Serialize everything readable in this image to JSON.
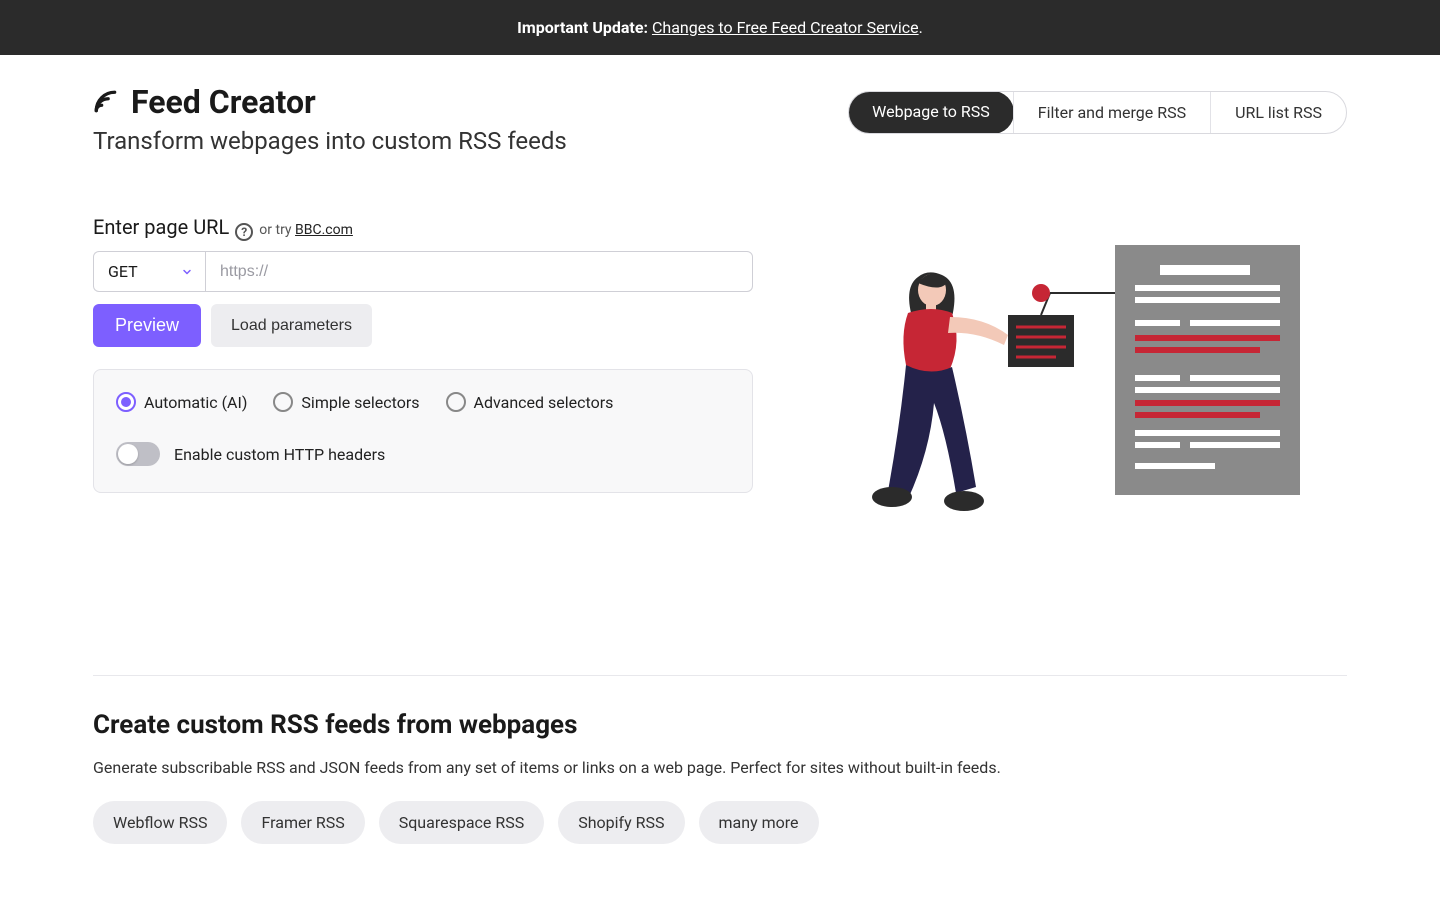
{
  "banner": {
    "prefix": "Important Update:",
    "link_text": "Changes to Free Feed Creator Service",
    "suffix": "."
  },
  "header": {
    "title": "Feed Creator",
    "subtitle": "Transform webpages into custom RSS feeds"
  },
  "tabs": [
    {
      "label": "Webpage to RSS",
      "active": true
    },
    {
      "label": "Filter and merge RSS",
      "active": false
    },
    {
      "label": "URL list RSS",
      "active": false
    }
  ],
  "form": {
    "label": "Enter page URL",
    "try_prefix": "or try",
    "try_link": "BBC.com",
    "method": "GET",
    "url_value": "",
    "url_placeholder": "https://",
    "preview_btn": "Preview",
    "load_btn": "Load parameters"
  },
  "options": {
    "radios": [
      {
        "label": "Automatic (AI)",
        "selected": true
      },
      {
        "label": "Simple selectors",
        "selected": false
      },
      {
        "label": "Advanced selectors",
        "selected": false
      }
    ],
    "toggle_label": "Enable custom HTTP headers",
    "toggle_on": false
  },
  "section": {
    "title": "Create custom RSS feeds from webpages",
    "desc": "Generate subscribable RSS and JSON feeds from any set of items or links on a web page. Perfect for sites without built-in feeds.",
    "chips": [
      "Webflow RSS",
      "Framer RSS",
      "Squarespace RSS",
      "Shopify RSS",
      "many more"
    ]
  },
  "colors": {
    "accent": "#7d5fff",
    "dark": "#2b2b2b",
    "illus_red": "#c62635",
    "illus_grey": "#8a8a8a"
  }
}
